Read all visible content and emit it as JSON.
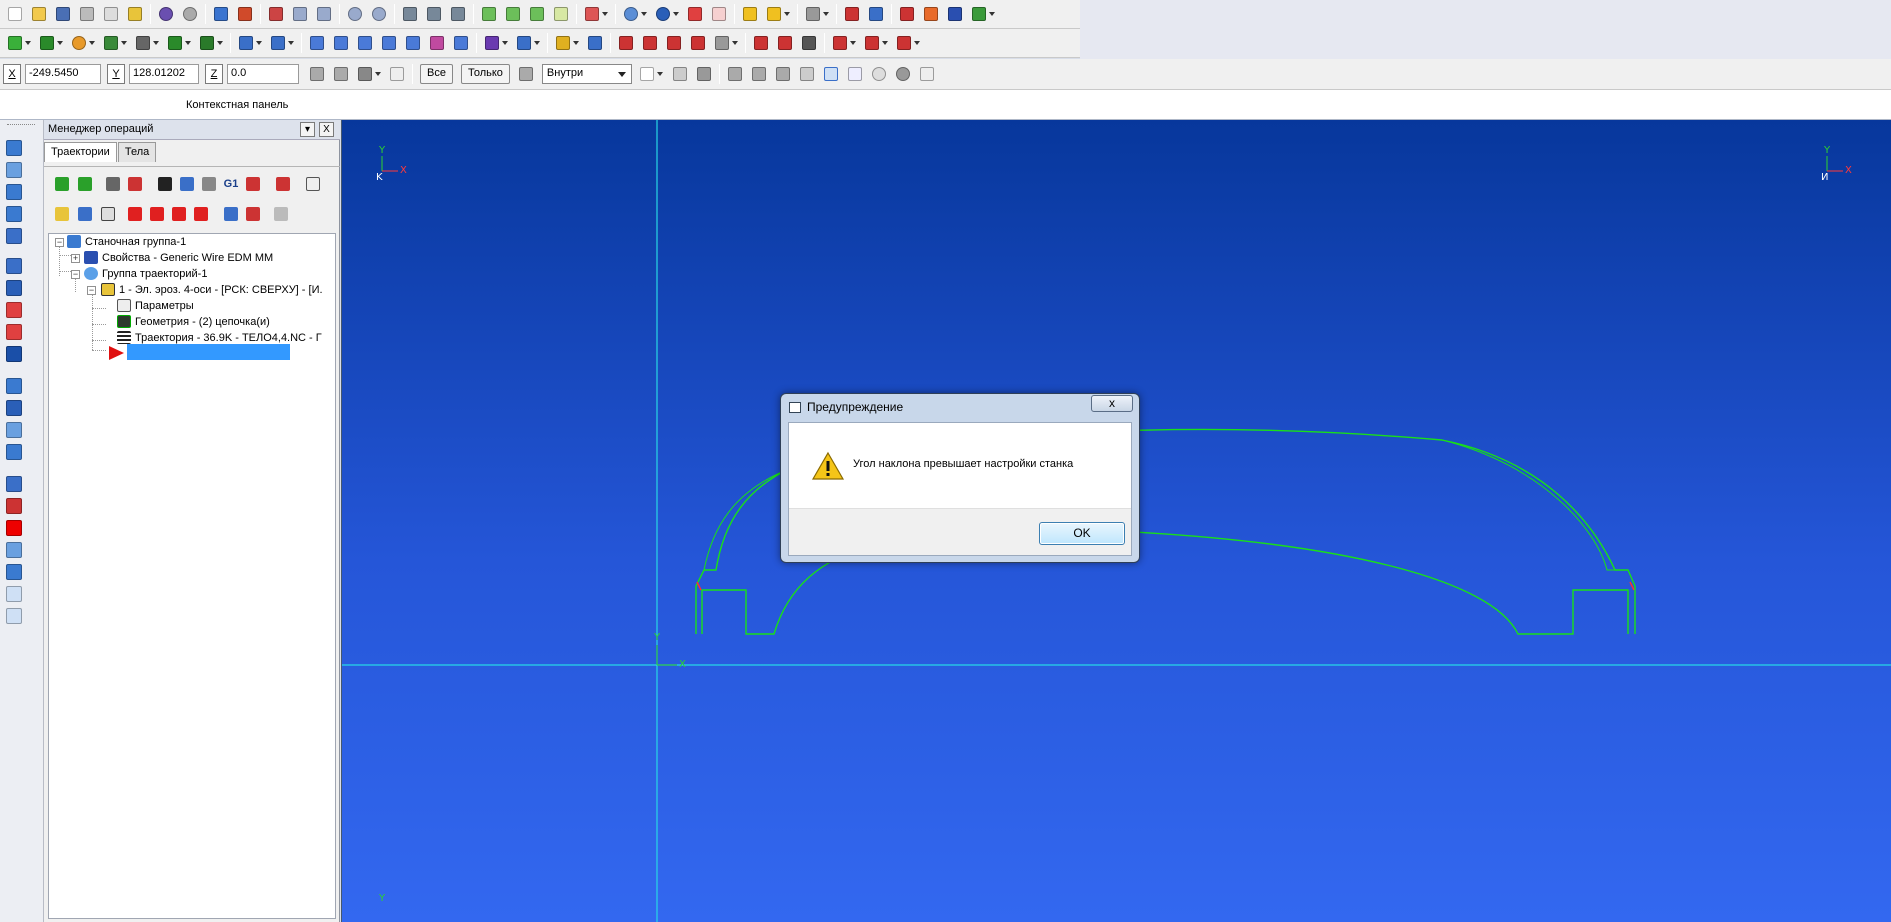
{
  "coords": {
    "x_label": "X",
    "x_value": "-249.5450",
    "y_label": "Y",
    "y_value": "128.01202",
    "z_label": "Z",
    "z_value": "0.0"
  },
  "toolbar3": {
    "all_button": "Все",
    "only_button": "Только",
    "mode_select": "Внутри"
  },
  "context_panel": {
    "title": "Контекстная панель"
  },
  "ops_manager": {
    "title": "Менеджер операций",
    "minimize": "▾",
    "close": "X",
    "tabs": [
      {
        "label": "Траектории",
        "active": true
      },
      {
        "label": "Тела",
        "active": false
      }
    ],
    "g1_label": "G1",
    "tree": [
      {
        "label": "Станочная группа-1",
        "level": 0,
        "icon": "machine-group-icon"
      },
      {
        "label": "Свойства - Generic Wire EDM MM",
        "level": 1,
        "icon": "properties-icon"
      },
      {
        "label": "Группа траекторий-1",
        "level": 1,
        "icon": "toolpath-group-icon"
      },
      {
        "label": "1 - Эл. эроз. 4-оси - [РСК: СВЕРХУ] - [И.",
        "level": 2,
        "icon": "operation-folder-icon"
      },
      {
        "label": "Параметры",
        "level": 3,
        "icon": "parameters-icon"
      },
      {
        "label": "Геометрия - (2) цепочка(и)",
        "level": 3,
        "icon": "geometry-icon"
      },
      {
        "label": "Траектория - 36.9K - ТЕЛО4,4.NC - Г",
        "level": 3,
        "icon": "toolpath-icon"
      }
    ]
  },
  "viewport": {
    "gnomon_left": {
      "y": "Y",
      "x": "X",
      "k": "K"
    },
    "gnomon_right": {
      "y": "Y",
      "x": "X",
      "k": "И"
    },
    "origin_y": "Y",
    "origin_x": "X",
    "bottom_y": "Y"
  },
  "dialog": {
    "title": "Предупреждение",
    "close": "x",
    "message": "Угол наклона превышает настройки станка",
    "ok_label": "OK",
    "icon": "warning-icon"
  },
  "colors": {
    "viewport_top": "#07379c",
    "viewport_bottom": "#3368f0",
    "geometry": "#19e019",
    "axis_lines": "#27d7e6",
    "selection": "#3399ff"
  }
}
